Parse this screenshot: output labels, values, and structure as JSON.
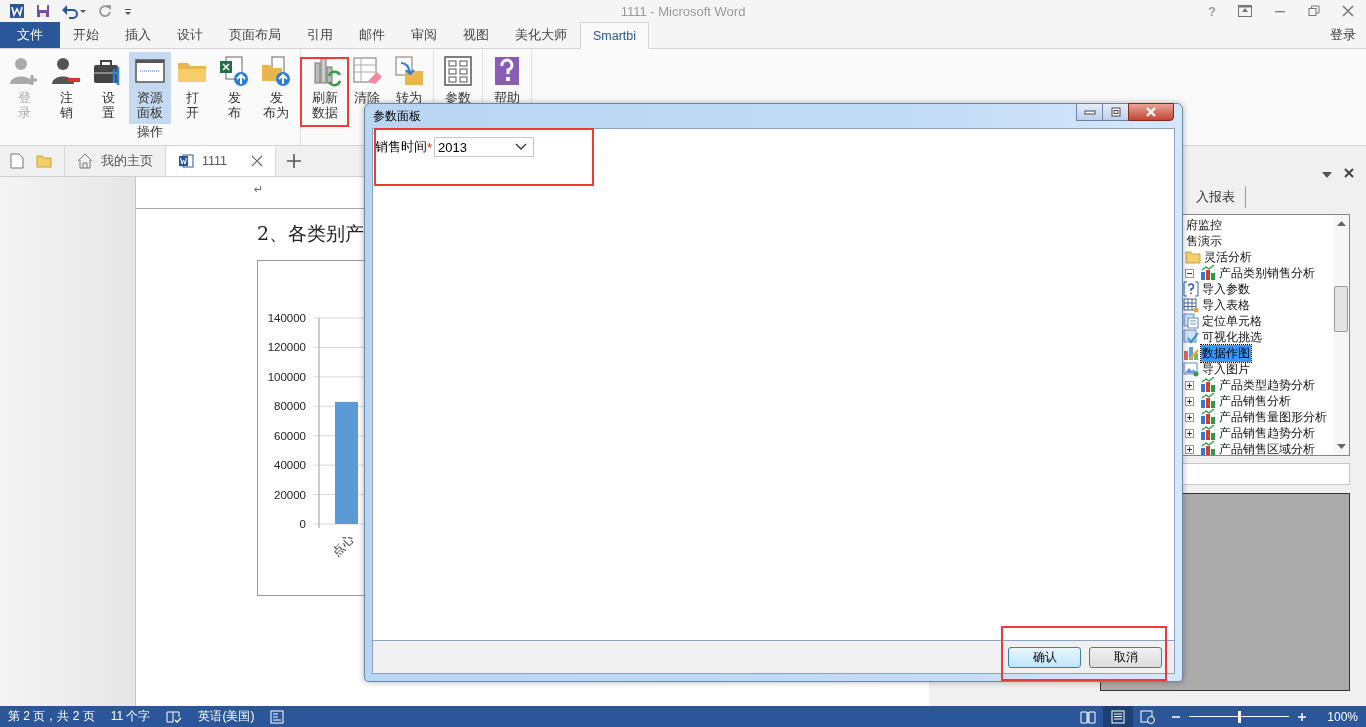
{
  "title_bar": {
    "title": "1111 - Microsoft Word",
    "help": "?",
    "account": "登录"
  },
  "ribbon_tabs": [
    {
      "label": "文件",
      "kind": "file",
      "selected": false
    },
    {
      "label": "开始",
      "kind": "tab",
      "selected": false
    },
    {
      "label": "插入",
      "kind": "tab",
      "selected": false
    },
    {
      "label": "设计",
      "kind": "tab",
      "selected": false
    },
    {
      "label": "页面布局",
      "kind": "tab",
      "selected": false
    },
    {
      "label": "引用",
      "kind": "tab",
      "selected": false
    },
    {
      "label": "邮件",
      "kind": "tab",
      "selected": false
    },
    {
      "label": "审阅",
      "kind": "tab",
      "selected": false
    },
    {
      "label": "视图",
      "kind": "tab",
      "selected": false
    },
    {
      "label": "美化大师",
      "kind": "tab",
      "selected": false
    },
    {
      "label": "Smartbi",
      "kind": "tab",
      "selected": true
    }
  ],
  "ribbon_groups": [
    {
      "label": "操作",
      "buttons": [
        {
          "kind": "user-add",
          "lines": [
            "登",
            "录"
          ],
          "disabled": true,
          "selected": false
        },
        {
          "kind": "user-remove",
          "lines": [
            "注",
            "销"
          ],
          "disabled": false,
          "selected": false
        },
        {
          "kind": "toolbox",
          "lines": [
            "设",
            "置"
          ],
          "disabled": false,
          "selected": false
        },
        {
          "kind": "panel",
          "lines": [
            "资源",
            "面板"
          ],
          "disabled": false,
          "selected": true
        },
        {
          "kind": "folder",
          "lines": [
            "打",
            "开"
          ],
          "disabled": false,
          "selected": false
        },
        {
          "kind": "excel-upload",
          "lines": [
            "发",
            "布"
          ],
          "disabled": false,
          "selected": false
        },
        {
          "kind": "folder-upload",
          "lines": [
            "发",
            "布为"
          ],
          "disabled": false,
          "selected": false
        }
      ]
    },
    {
      "buttons": [
        {
          "kind": "chart-refresh",
          "lines": [
            "刷新",
            "数据"
          ],
          "disabled": false,
          "selected": false
        },
        {
          "kind": "eraser",
          "lines": [
            "清除"
          ],
          "disabled": false,
          "selected": false
        },
        {
          "kind": "convert",
          "lines": [
            "转为"
          ],
          "disabled": false,
          "selected": false
        }
      ]
    },
    {
      "buttons": [
        {
          "kind": "grid",
          "lines": [
            "参数"
          ],
          "disabled": false,
          "selected": false
        }
      ]
    },
    {
      "buttons": [
        {
          "kind": "help",
          "lines": [
            "帮助"
          ],
          "disabled": false,
          "selected": false
        }
      ]
    }
  ],
  "doc_tabs": [
    {
      "kind": "home",
      "label": "我的主页",
      "selected": false
    },
    {
      "kind": "word",
      "label": "1111",
      "selected": true
    }
  ],
  "document": {
    "return_mark": "↵",
    "heading": "2、各类别产",
    "chart_data": {
      "type": "bar",
      "categories": [
        "点心"
      ],
      "values": [
        83000
      ],
      "grid": true,
      "ylim": [
        0,
        140000
      ],
      "yticks": [
        0,
        20000,
        40000,
        60000,
        80000,
        100000,
        120000,
        140000
      ]
    }
  },
  "dialog": {
    "title": "参数面板",
    "params": [
      {
        "label": "销售时间",
        "required_mark": "*",
        "value": "2013"
      }
    ],
    "buttons": [
      {
        "label": "确认",
        "focused": true
      },
      {
        "label": "取消",
        "focused": false
      }
    ]
  },
  "task_pane": {
    "tab": "入报表",
    "tree": [
      {
        "label": "府监控",
        "kind": "none",
        "selected": false
      },
      {
        "label": "售演示",
        "kind": "none",
        "selected": false
      },
      {
        "label": "灵活分析",
        "kind": "folder",
        "selected": false,
        "children": [
          {
            "label": "产品类别销售分析",
            "kind": "report",
            "expanded": true,
            "selected": false,
            "children": [
              {
                "label": "导入参数",
                "kind": "param",
                "selected": false
              },
              {
                "label": "导入表格",
                "kind": "table",
                "selected": false
              },
              {
                "label": "定位单元格",
                "kind": "cell",
                "selected": false
              },
              {
                "label": "可视化挑选",
                "kind": "filter",
                "selected": false
              },
              {
                "label": "数据作图",
                "kind": "chart",
                "selected": true
              },
              {
                "label": "导入图片",
                "kind": "image",
                "selected": false
              }
            ]
          },
          {
            "label": "产品类型趋势分析",
            "kind": "report",
            "expanded": false,
            "selected": false
          },
          {
            "label": "产品销售分析",
            "kind": "report",
            "expanded": false,
            "selected": false
          },
          {
            "label": "产品销售量图形分析",
            "kind": "report",
            "expanded": false,
            "selected": false
          },
          {
            "label": "产品销售趋势分析",
            "kind": "report",
            "expanded": false,
            "selected": false
          },
          {
            "label": "产品销售区域分析",
            "kind": "report",
            "expanded": false,
            "selected": false
          }
        ]
      }
    ]
  },
  "status_bar": {
    "page_count": "第 2 页，共 2 页",
    "word_count": "11 个字",
    "language": "英语(美国)",
    "views": [
      {
        "kind": "read",
        "selected": false
      },
      {
        "kind": "print",
        "selected": true
      },
      {
        "kind": "web",
        "selected": false
      }
    ],
    "zoom_slider": {
      "level": 0.5
    },
    "zoom": "100%"
  }
}
